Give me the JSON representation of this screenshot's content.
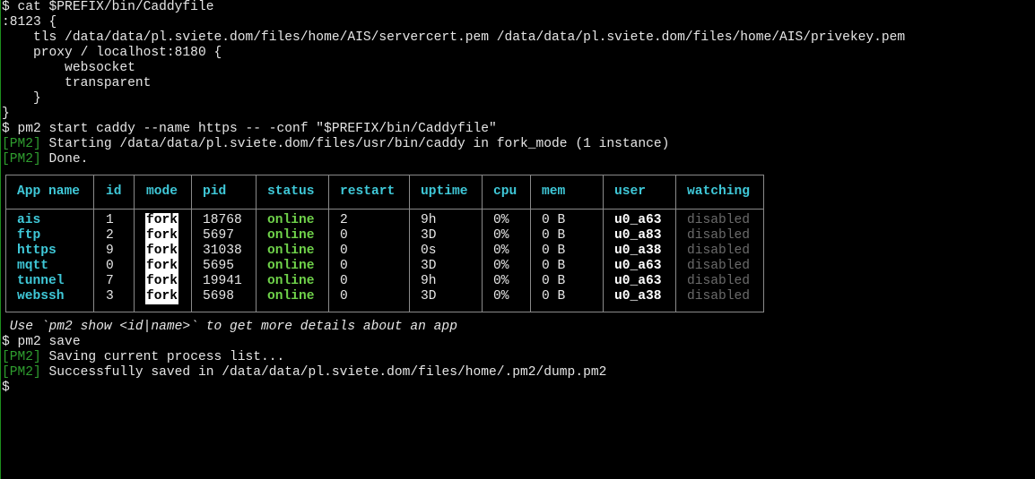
{
  "terminal": {
    "lines": [
      "$ cat $PREFIX/bin/Caddyfile",
      ":8123 {",
      "    tls /data/data/pl.sviete.dom/files/home/AIS/servercert.pem /data/data/pl.sviete.dom/files/home/AIS/privekey.pem",
      "    proxy / localhost:8180 {",
      "        websocket",
      "        transparent",
      "    }",
      "}",
      "$ pm2 start caddy --name https -- -conf \"$PREFIX/bin/Caddyfile\""
    ],
    "pm2_tag": "[PM2]",
    "pm2_start_msg": " Starting /data/data/pl.sviete.dom/files/usr/bin/caddy in fork_mode (1 instance)",
    "pm2_done_msg": " Done.",
    "hint": " Use `pm2 show <id|name>` to get more details about an app",
    "save_cmd": "$ pm2 save",
    "pm2_saving_msg": " Saving current process list...",
    "pm2_saved_msg": " Successfully saved in /data/data/pl.sviete.dom/files/home/.pm2/dump.pm2",
    "prompt": "$"
  },
  "table": {
    "headers": [
      "App name",
      "id",
      "mode",
      "pid",
      "status",
      "restart",
      "uptime",
      "cpu",
      "mem",
      "user",
      "watching"
    ],
    "rows": [
      {
        "name": "ais",
        "id": "1",
        "mode": "fork",
        "pid": "18768",
        "status": "online",
        "restart": "2",
        "uptime": "9h",
        "cpu": "0%",
        "mem": "0 B",
        "user": "u0_a63",
        "watching": "disabled"
      },
      {
        "name": "ftp",
        "id": "2",
        "mode": "fork",
        "pid": "5697",
        "status": "online",
        "restart": "0",
        "uptime": "3D",
        "cpu": "0%",
        "mem": "0 B",
        "user": "u0_a83",
        "watching": "disabled"
      },
      {
        "name": "https",
        "id": "9",
        "mode": "fork",
        "pid": "31038",
        "status": "online",
        "restart": "0",
        "uptime": "0s",
        "cpu": "0%",
        "mem": "0 B",
        "user": "u0_a38",
        "watching": "disabled"
      },
      {
        "name": "mqtt",
        "id": "0",
        "mode": "fork",
        "pid": "5695",
        "status": "online",
        "restart": "0",
        "uptime": "3D",
        "cpu": "0%",
        "mem": "0 B",
        "user": "u0_a63",
        "watching": "disabled"
      },
      {
        "name": "tunnel",
        "id": "7",
        "mode": "fork",
        "pid": "19941",
        "status": "online",
        "restart": "0",
        "uptime": "9h",
        "cpu": "0%",
        "mem": "0 B",
        "user": "u0_a63",
        "watching": "disabled"
      },
      {
        "name": "webssh",
        "id": "3",
        "mode": "fork",
        "pid": "5698",
        "status": "online",
        "restart": "0",
        "uptime": "3D",
        "cpu": "0%",
        "mem": "0 B",
        "user": "u0_a38",
        "watching": "disabled"
      }
    ]
  },
  "colors": {
    "background": "#000000",
    "text": "#e6e6e6",
    "pm2_tag": "#2f9e2f",
    "header_cyan": "#3fc8d8",
    "online_green": "#6fd24a",
    "disabled_gray": "#6a6a6a"
  }
}
